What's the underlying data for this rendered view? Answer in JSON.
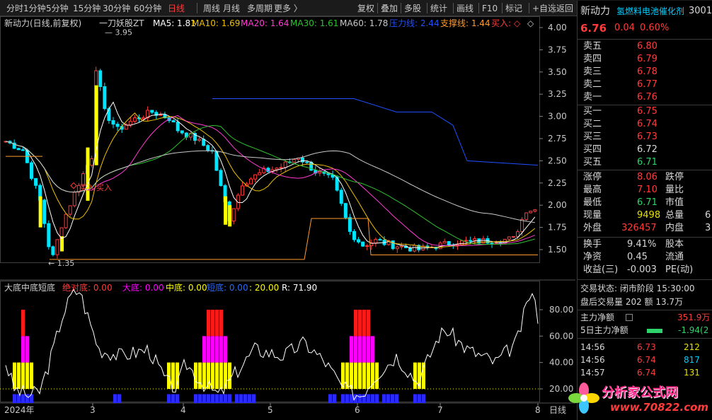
{
  "toolbar": {
    "periods": [
      "分时",
      "1分钟",
      "5分钟",
      "15分钟",
      "30分钟",
      "60分钟",
      "日线",
      "周线",
      "月线",
      "多周期",
      "更多 〉"
    ],
    "active_period": "日线",
    "buttons": [
      "复权",
      "叠加",
      "多股",
      "统计",
      "画线",
      "F10",
      "标记",
      "+自选",
      "返回"
    ]
  },
  "chart_legend": {
    "stock": "新动力(日线,前复权)",
    "indicator": "一刀妖股ZT",
    "ma5": "MA5: 1.81",
    "ma10": "MA10: 1.69",
    "ma20": "MA20: 1.64",
    "ma30": "MA30: 1.61",
    "ma60": "MA60: 1.78",
    "pressure": "压力线: 2.44",
    "support": "支撑线: 1.44",
    "buy": "买入: ◇",
    "max_label": "3.95",
    "min_label": "1.35",
    "buy_marker_1": "买入",
    "buy_marker_2": "买入"
  },
  "price_axis": [
    "4.00",
    "3.75",
    "3.50",
    "3.25",
    "3.00",
    "2.75",
    "2.50",
    "2.25",
    "2.00",
    "1.75",
    "1.50"
  ],
  "sub_legend": {
    "name": "大底中底短底",
    "absolute": "绝对底: 0.00",
    "big": "大底: 0.00",
    "mid": "中底: 0.00",
    "short": "短底: 0.00",
    "twenty": ": 20.00",
    "r": "R: 71.90"
  },
  "sub_axis": [
    "80.00",
    "60.00",
    "40.00",
    "20.00"
  ],
  "date_axis": {
    "year": "2024年",
    "months": [
      "3",
      "4",
      "5",
      "6",
      "7",
      "8"
    ],
    "cut": "日线"
  },
  "colors": {
    "up": "#ff3b3b",
    "down": "#00e5ff",
    "ma5": "#ffffff",
    "ma10": "#f0c000",
    "ma20": "#ff3bd4",
    "ma30": "#30c030",
    "ma60": "#c8c8c8",
    "pressure": "#2050ff",
    "support": "#ff9a2e",
    "yellow": "#ffff00",
    "magenta": "#ff00ff",
    "blue": "#2a2aff"
  },
  "quote": {
    "name": "新动力",
    "concept": "氢燃料电池催化剂",
    "code": "3001",
    "price": "6.76",
    "change": "0.04",
    "pct": "0.60%",
    "asks": [
      {
        "label": "卖五",
        "price": "6.80"
      },
      {
        "label": "卖四",
        "price": "6.79"
      },
      {
        "label": "卖三",
        "price": "6.78"
      },
      {
        "label": "卖二",
        "price": "6.77"
      },
      {
        "label": "卖一",
        "price": "6.76"
      }
    ],
    "bids": [
      {
        "label": "买一",
        "price": "6.75"
      },
      {
        "label": "买二",
        "price": "6.74"
      },
      {
        "label": "买三",
        "price": "6.73"
      },
      {
        "label": "买四",
        "price": "6.72"
      },
      {
        "label": "买五",
        "price": "6.71"
      }
    ],
    "stats": [
      {
        "l": "涨停",
        "v": "8.06",
        "r": "跌停"
      },
      {
        "l": "最高",
        "v": "7.10",
        "r": "量比"
      },
      {
        "l": "最低",
        "v": "6.71",
        "r": "市值"
      },
      {
        "l": "现量",
        "v": "9498",
        "r": "总量",
        "r2": "6"
      },
      {
        "l": "外盘",
        "v": "326457",
        "r": "内盘",
        "r2": "3"
      }
    ],
    "stats2": [
      {
        "l": "换手",
        "v": "9.41%",
        "r": "股本"
      },
      {
        "l": "净资",
        "v": "0.45",
        "r": "流通"
      },
      {
        "l": "收益(三)",
        "v": "-0.003",
        "r": "PE(动)"
      }
    ],
    "trade_status": "交易状态: 闭市阶段 15:30:00",
    "after_hours": "盘后交易量 202 额 13.7万",
    "main_flow_label": "主力净额",
    "main_flow_value": "351.9万",
    "five_day_label": "5日主力净额",
    "five_day_value": "-1.94(2",
    "ticks": [
      {
        "t": "14:56",
        "p": "6.73",
        "v": "212"
      },
      {
        "t": "14:56",
        "p": "6.74",
        "v": "817"
      },
      {
        "t": "14:57",
        "p": "6.74",
        "v": "131"
      }
    ]
  },
  "logo": {
    "text": "分析家公式网",
    "url": "www.70822.com"
  }
}
